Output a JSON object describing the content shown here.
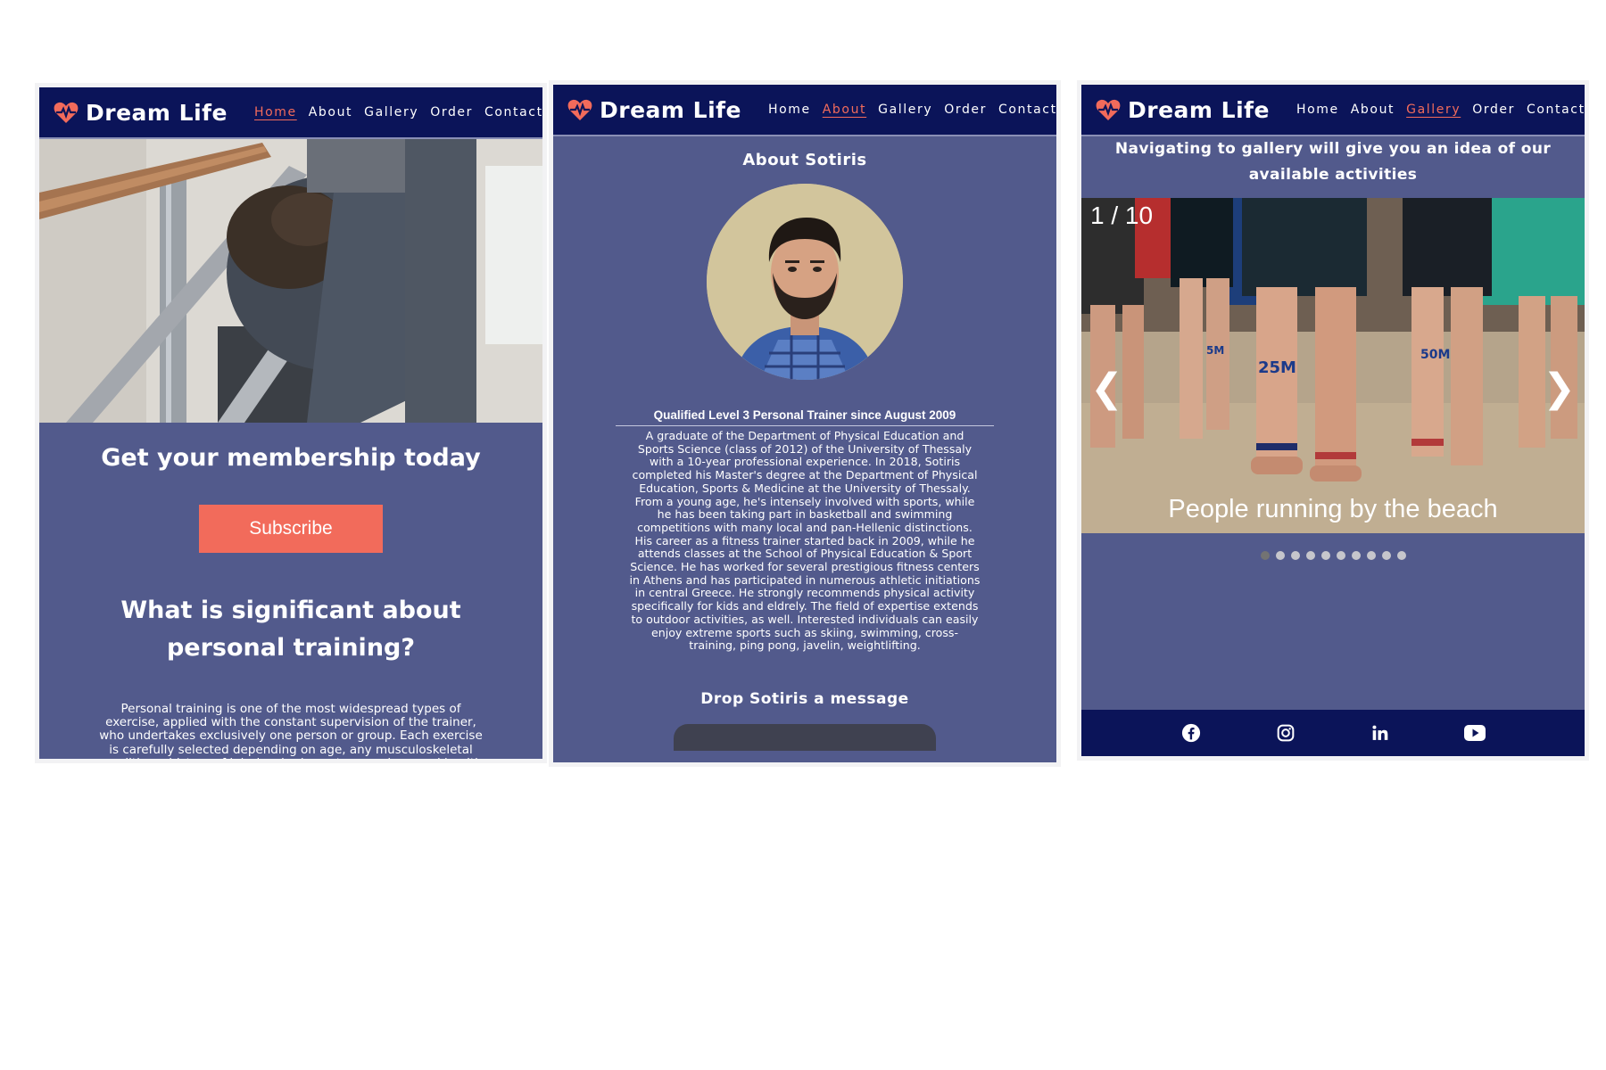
{
  "panels": [
    {
      "brand": "Dream Life",
      "nav": [
        "Home",
        "About",
        "Gallery",
        "Order",
        "Contact"
      ],
      "active_nav": "Home",
      "cta_heading": "Get your membership today",
      "subscribe_label": "Subscribe",
      "section_heading": "What is significant about personal training?",
      "section_text": "Personal training is one of the most widespread types of exercise, applied with the constant supervision of the trainer, who undertakes exclusively one person or group. Each exercise is carefully selected depending on age, any musculoskeletal conditions, history of injuries, body posture, and general health status. The correct"
    },
    {
      "brand": "Dream Life",
      "nav": [
        "Home",
        "About",
        "Gallery",
        "Order",
        "Contact"
      ],
      "active_nav": "About",
      "about_heading": "About Sotiris",
      "qualification": "Qualified Level 3 Personal Trainer since August 2009",
      "bio": "A graduate of the Department of Physical Education and Sports Science (class of 2012) of the University of Thessaly with a 10-year professional experience. In 2018, Sotiris completed his Master's degree at the Department of Physical Education, Sports & Medicine at the University of Thessaly. From a young age, he's intensely involved with sports, while he has been taking part in basketball and swimming competitions with many local and pan-Hellenic distinctions. His career as a fitness trainer started back in 2009, while he attends classes at the School of Physical Education & Sport Science. He has worked for several prestigious fitness centers in Athens and has participated in numerous athletic initiations in central Greece. He strongly recommends physical activity specifically for kids and eldrely. The field of expertise extends to outdoor activities, as well. Interested individuals can easily enjoy extreme sports such as skiing, swimming, cross-training, ping pong, javelin, weightlifting.",
      "message_heading": "Drop Sotiris a message"
    },
    {
      "brand": "Dream Life",
      "nav": [
        "Home",
        "About",
        "Gallery",
        "Order",
        "Contact"
      ],
      "active_nav": "Gallery",
      "gallery_heading": "Navigating to gallery will give you an idea of our available activities",
      "slide_counter": "1 / 10",
      "slide_caption": "People running by the beach",
      "prev_arrow": "❮",
      "next_arrow": "❯",
      "slide_count": 10,
      "active_slide": 1,
      "bib_labels": [
        "25M",
        "5M",
        "50M"
      ],
      "social": [
        "facebook-icon",
        "instagram-icon",
        "linkedin-icon",
        "youtube-icon"
      ]
    }
  ],
  "colors": {
    "navbar": "#0b1459",
    "panel_bg": "#525a8c",
    "accent": "#f26b5b"
  }
}
